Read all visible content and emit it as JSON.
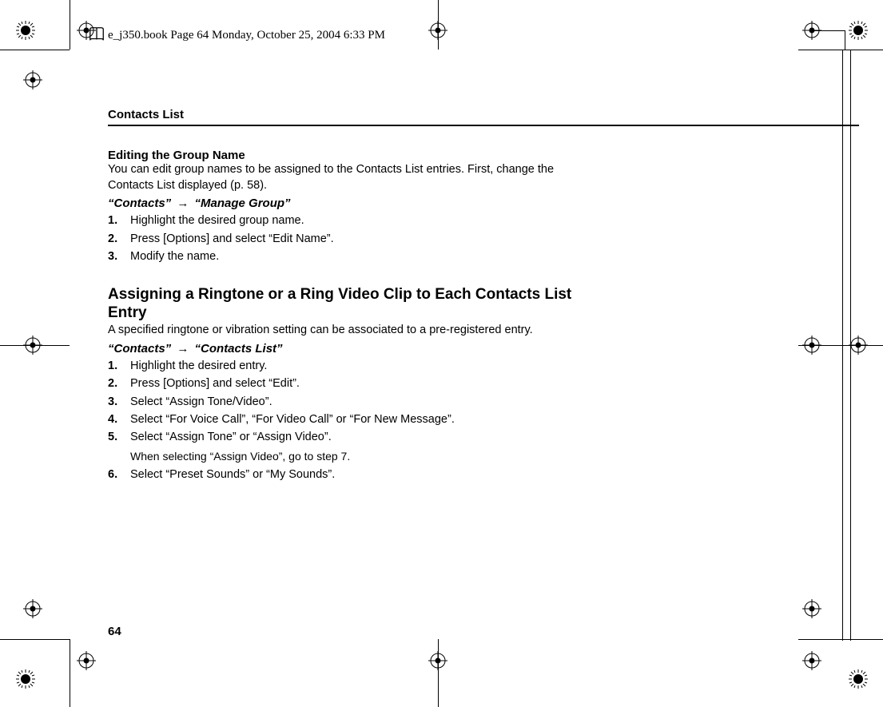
{
  "meta": {
    "header_line": "e_j350.book  Page 64  Monday, October 25, 2004  6:33 PM"
  },
  "page": {
    "section_title": "Contacts List",
    "page_number": "64"
  },
  "block1": {
    "heading": "Editing the Group Name",
    "intro": "You can edit group names to be assigned to the Contacts List entries. First, change the Contacts List displayed (p. 58).",
    "nav_a": "“Contacts”",
    "nav_b": "“Manage Group”",
    "steps": [
      "Highlight the desired group name.",
      "Press [Options] and select “Edit Name”.",
      "Modify the name."
    ]
  },
  "block2": {
    "heading": "Assigning a Ringtone or a Ring Video Clip to Each Contacts List Entry",
    "intro": "A specified ringtone or vibration setting can be associated to a pre-registered entry.",
    "nav_a": "“Contacts”",
    "nav_b": "“Contacts List”",
    "steps": [
      "Highlight the desired entry.",
      "Press [Options] and select “Edit”.",
      "Select “Assign Tone/Video”.",
      "Select “For Voice Call”, “For Video Call” or “For New Message”.",
      "Select “Assign Tone” or “Assign Video”.",
      "Select “Preset Sounds” or “My Sounds”."
    ],
    "step5_note": "When selecting “Assign Video”, go to step 7."
  },
  "glyphs": {
    "arrow": "→"
  }
}
